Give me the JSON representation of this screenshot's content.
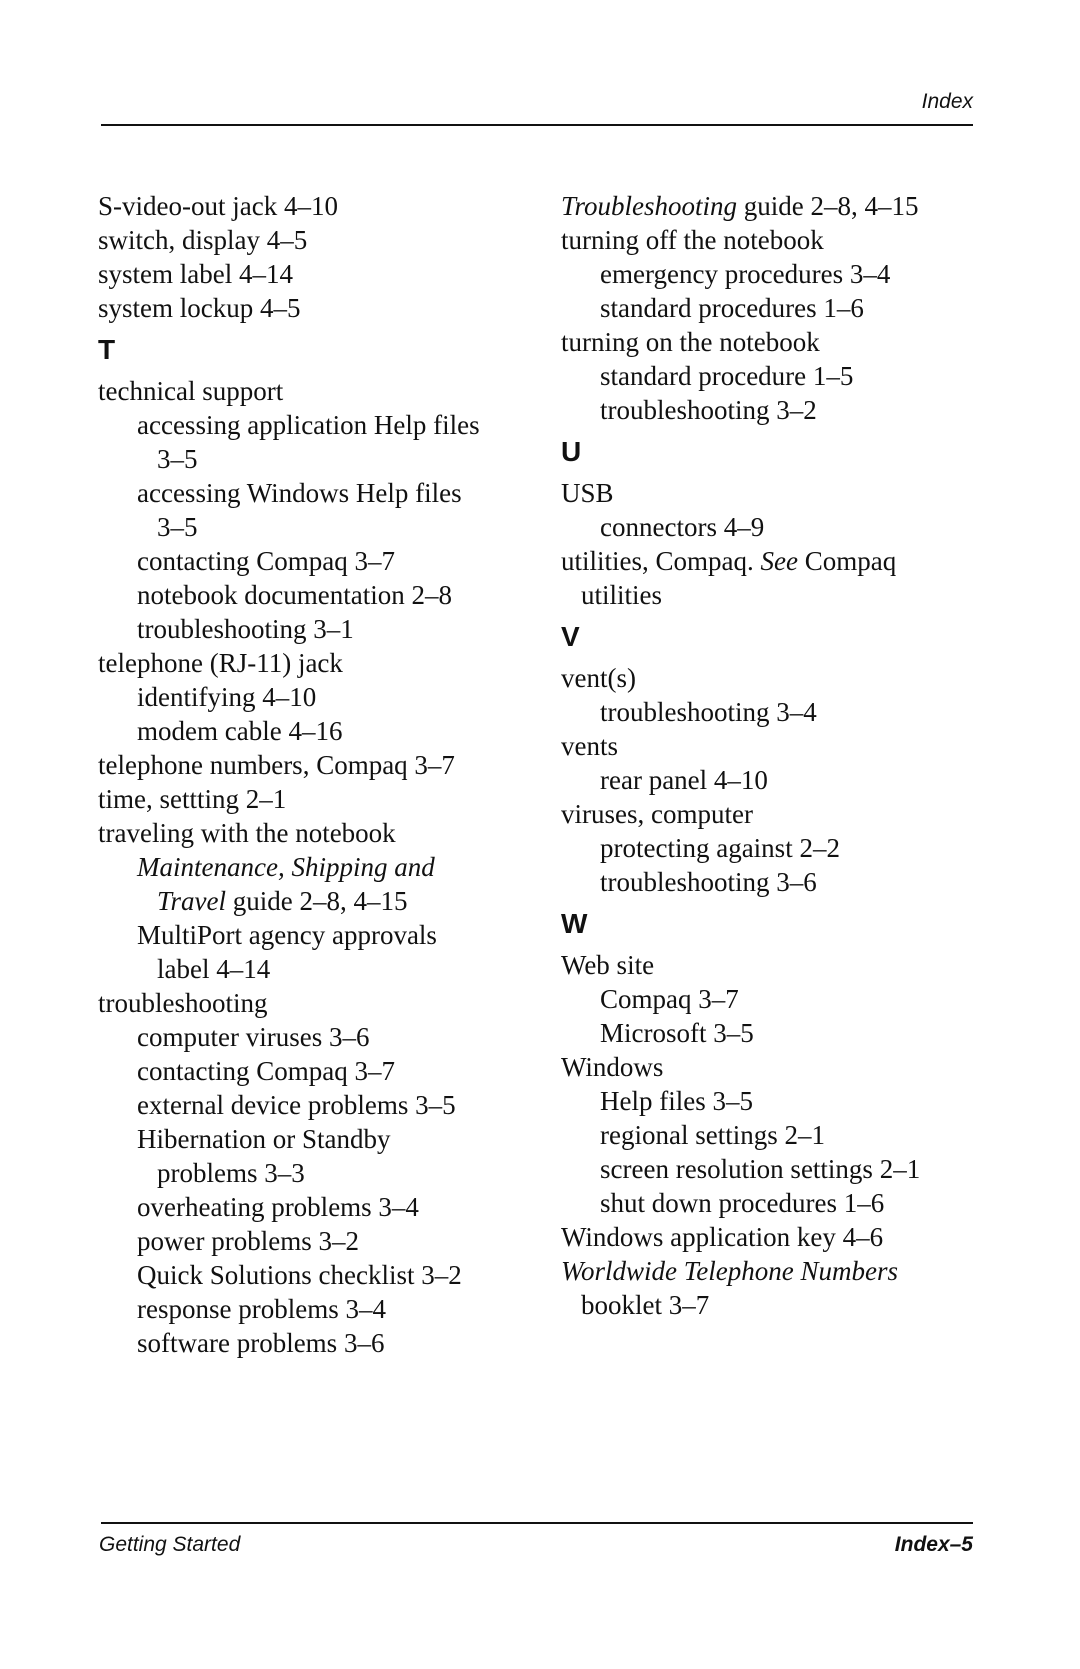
{
  "header": {
    "title": "Index"
  },
  "footer": {
    "left": "Getting Started",
    "right": "Index–5"
  },
  "left_column": [
    {
      "type": "entry",
      "level": 1,
      "text": "S-video-out jack 4–10"
    },
    {
      "type": "entry",
      "level": 1,
      "text": "switch, display 4–5"
    },
    {
      "type": "entry",
      "level": 1,
      "text": "system label 4–14"
    },
    {
      "type": "entry",
      "level": 1,
      "text": "system lockup 4–5"
    },
    {
      "type": "letter",
      "text": "T"
    },
    {
      "type": "entry",
      "level": 1,
      "text": "technical support"
    },
    {
      "type": "entry",
      "level": 2,
      "text": "accessing application Help files"
    },
    {
      "type": "entry",
      "level": 3,
      "text": "3–5"
    },
    {
      "type": "entry",
      "level": 2,
      "text": "accessing Windows Help files"
    },
    {
      "type": "entry",
      "level": 3,
      "text": "3–5"
    },
    {
      "type": "entry",
      "level": 2,
      "text": "contacting Compaq 3–7"
    },
    {
      "type": "entry",
      "level": 2,
      "text": "notebook documentation 2–8"
    },
    {
      "type": "entry",
      "level": 2,
      "text": "troubleshooting 3–1"
    },
    {
      "type": "entry",
      "level": 1,
      "text": "telephone (RJ-11) jack"
    },
    {
      "type": "entry",
      "level": 2,
      "text": "identifying 4–10"
    },
    {
      "type": "entry",
      "level": 2,
      "text": "modem cable 4–16"
    },
    {
      "type": "entry",
      "level": 1,
      "text": "telephone numbers, Compaq 3–7"
    },
    {
      "type": "entry",
      "level": 1,
      "text": "time, settting 2–1"
    },
    {
      "type": "entry",
      "level": 1,
      "text": "traveling with the notebook"
    },
    {
      "type": "entry",
      "level": 2,
      "italic": "Maintenance, Shipping and",
      "text": ""
    },
    {
      "type": "entry",
      "level": 3,
      "italic": "Travel",
      "text": " guide 2–8, 4–15"
    },
    {
      "type": "entry",
      "level": 2,
      "text": "MultiPort agency approvals"
    },
    {
      "type": "entry",
      "level": 3,
      "text": "label 4–14"
    },
    {
      "type": "entry",
      "level": 1,
      "text": "troubleshooting"
    },
    {
      "type": "entry",
      "level": 2,
      "text": "computer viruses 3–6"
    },
    {
      "type": "entry",
      "level": 2,
      "text": "contacting Compaq 3–7"
    },
    {
      "type": "entry",
      "level": 2,
      "text": "external device problems 3–5"
    },
    {
      "type": "entry",
      "level": 2,
      "text": "Hibernation or Standby"
    },
    {
      "type": "entry",
      "level": 3,
      "text": "problems 3–3"
    },
    {
      "type": "entry",
      "level": 2,
      "text": "overheating problems 3–4"
    },
    {
      "type": "entry",
      "level": 2,
      "text": "power problems 3–2"
    },
    {
      "type": "entry",
      "level": 2,
      "text": "Quick Solutions checklist 3–2"
    },
    {
      "type": "entry",
      "level": 2,
      "text": "response problems 3–4"
    },
    {
      "type": "entry",
      "level": 2,
      "text": "software problems 3–6"
    }
  ],
  "right_column": [
    {
      "type": "entry",
      "level": 1,
      "italic": "Troubleshooting",
      "text": " guide 2–8, 4–15"
    },
    {
      "type": "entry",
      "level": 1,
      "text": "turning off the notebook"
    },
    {
      "type": "entry",
      "level": 2,
      "text": "emergency procedures 3–4"
    },
    {
      "type": "entry",
      "level": 2,
      "text": "standard procedures 1–6"
    },
    {
      "type": "entry",
      "level": 1,
      "text": "turning on the notebook"
    },
    {
      "type": "entry",
      "level": 2,
      "text": "standard procedure 1–5"
    },
    {
      "type": "entry",
      "level": 2,
      "text": "troubleshooting 3–2"
    },
    {
      "type": "letter",
      "text": "U"
    },
    {
      "type": "entry",
      "level": 1,
      "text": "USB"
    },
    {
      "type": "entry",
      "level": 2,
      "text": "connectors 4–9"
    },
    {
      "type": "entry",
      "level": 1,
      "text": "utilities, Compaq. ",
      "italic_mid": "See",
      "text_after": " Compaq"
    },
    {
      "type": "entry",
      "level": "c",
      "text": "utilities"
    },
    {
      "type": "letter",
      "text": "V"
    },
    {
      "type": "entry",
      "level": 1,
      "text": "vent(s)"
    },
    {
      "type": "entry",
      "level": 2,
      "text": "troubleshooting 3–4"
    },
    {
      "type": "entry",
      "level": 1,
      "text": "vents"
    },
    {
      "type": "entry",
      "level": 2,
      "text": "rear panel 4–10"
    },
    {
      "type": "entry",
      "level": 1,
      "text": "viruses, computer"
    },
    {
      "type": "entry",
      "level": 2,
      "text": "protecting against 2–2"
    },
    {
      "type": "entry",
      "level": 2,
      "text": "troubleshooting 3–6"
    },
    {
      "type": "letter",
      "text": "W"
    },
    {
      "type": "entry",
      "level": 1,
      "text": "Web site"
    },
    {
      "type": "entry",
      "level": 2,
      "text": "Compaq 3–7"
    },
    {
      "type": "entry",
      "level": 2,
      "text": "Microsoft 3–5"
    },
    {
      "type": "entry",
      "level": 1,
      "text": "Windows"
    },
    {
      "type": "entry",
      "level": 2,
      "text": "Help files 3–5"
    },
    {
      "type": "entry",
      "level": 2,
      "text": "regional settings 2–1"
    },
    {
      "type": "entry",
      "level": 2,
      "text": "screen resolution settings 2–1"
    },
    {
      "type": "entry",
      "level": 2,
      "text": "shut down procedures 1–6"
    },
    {
      "type": "entry",
      "level": 1,
      "text": "Windows application key 4–6"
    },
    {
      "type": "entry",
      "level": 1,
      "italic": "Worldwide Telephone Numbers",
      "text": ""
    },
    {
      "type": "entry",
      "level": "c",
      "text": "booklet 3–7"
    }
  ]
}
